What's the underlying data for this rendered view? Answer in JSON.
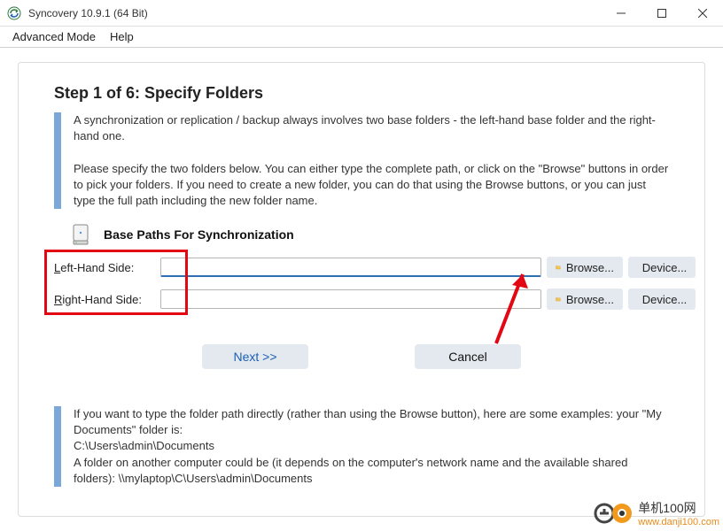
{
  "titlebar": {
    "title": "Syncovery 10.9.1 (64 Bit)"
  },
  "menubar": {
    "advanced": "Advanced Mode",
    "help": "Help"
  },
  "step": {
    "title": "Step 1 of 6: Specify Folders"
  },
  "desc": {
    "p1": "A synchronization or replication / backup always involves two base folders - the left-hand base folder and the right-hand one.",
    "p2": "Please specify the two folders below. You can either type the complete path, or click on the \"Browse\" buttons in order to pick your folders. If you need to create a new folder, you can do that using the Browse buttons, or you can just type the full path including the new folder name."
  },
  "section": {
    "title": "Base Paths For Synchronization"
  },
  "rows": {
    "left": {
      "label_pre": "L",
      "label_rest": "eft-Hand Side:",
      "value": "",
      "browse": "Browse...",
      "device": "Device..."
    },
    "right": {
      "label_pre": "R",
      "label_rest": "ight-Hand Side:",
      "value": "",
      "browse": "Browse...",
      "device": "Device..."
    }
  },
  "nav": {
    "next": "Next >>",
    "cancel": "Cancel"
  },
  "help": {
    "l1": "If you want to type the folder path directly (rather than using the Browse button), here are some examples: your \"My Documents\" folder is:",
    "l2": "C:\\Users\\admin\\Documents",
    "l3": "A folder on another computer could be (it depends on the computer's network name and the available shared folders): \\\\mylaptop\\C\\Users\\admin\\Documents"
  },
  "watermark": {
    "cn": "单机100网",
    "url": "www.danji100.com"
  }
}
